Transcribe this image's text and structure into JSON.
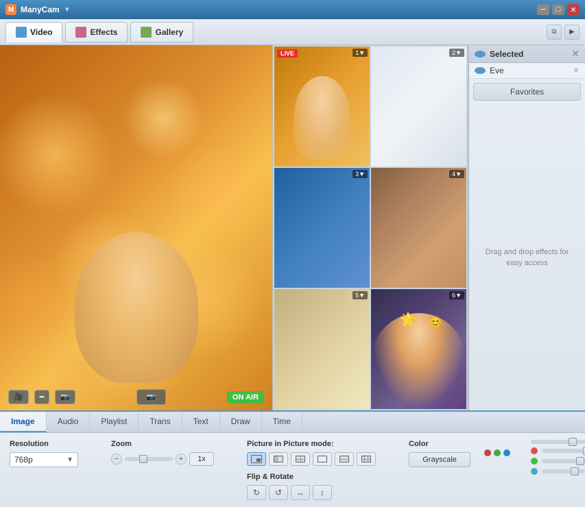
{
  "app": {
    "title": "ManyCam",
    "version": "v"
  },
  "titlebar": {
    "minimize": "─",
    "maximize": "□",
    "close": "✕"
  },
  "toolbar": {
    "tabs": [
      {
        "id": "video",
        "label": "Video",
        "active": true
      },
      {
        "id": "effects",
        "label": "Effects",
        "active": false
      },
      {
        "id": "gallery",
        "label": "Gallery",
        "active": false
      }
    ]
  },
  "video_grid": {
    "cells": [
      {
        "id": 1,
        "badge": "LIVE",
        "num": "1▼",
        "is_live": true
      },
      {
        "id": 2,
        "badge": "",
        "num": "2▼",
        "is_live": false
      },
      {
        "id": 3,
        "badge": "",
        "num": "3▼",
        "is_live": false
      },
      {
        "id": 4,
        "badge": "",
        "num": "4▼",
        "is_live": false
      },
      {
        "id": 5,
        "badge": "",
        "num": "5▼",
        "is_live": false
      },
      {
        "id": 6,
        "badge": "",
        "num": "6▼",
        "is_live": false
      }
    ]
  },
  "selected_panel": {
    "header_label": "Selected",
    "items": [
      {
        "label": "Eve",
        "id": "eve"
      }
    ],
    "favorites_label": "Favorites",
    "drag_hint": "Drag and drop effects for easy access"
  },
  "video_controls": {
    "onair_label": "ON AIR"
  },
  "bottom_tabs": {
    "tabs": [
      {
        "id": "image",
        "label": "Image",
        "active": true
      },
      {
        "id": "audio",
        "label": "Audio",
        "active": false
      },
      {
        "id": "playlist",
        "label": "Playlist",
        "active": false
      },
      {
        "id": "trans",
        "label": "Trans",
        "active": false
      },
      {
        "id": "text",
        "label": "Text",
        "active": false
      },
      {
        "id": "draw",
        "label": "Draw",
        "active": false
      },
      {
        "id": "time",
        "label": "Time",
        "active": false
      }
    ]
  },
  "settings": {
    "resolution_label": "Resolution",
    "resolution_value": "768p",
    "zoom_label": "Zoom",
    "pip_label": "Picture in Picture mode:",
    "flip_label": "Flip & Rotate",
    "color_label": "Color",
    "grayscale_label": "Grayscale",
    "color_sliders": [
      {
        "color": "#e05050",
        "position": 60
      },
      {
        "color": "#dd4444",
        "position": 70
      },
      {
        "color": "#44bb44",
        "position": 55
      },
      {
        "color": "#44aacc",
        "position": 45
      }
    ],
    "color_dots_top": [
      {
        "color": "#cc4444"
      },
      {
        "color": "#44aa44"
      },
      {
        "color": "#2288cc"
      }
    ]
  }
}
